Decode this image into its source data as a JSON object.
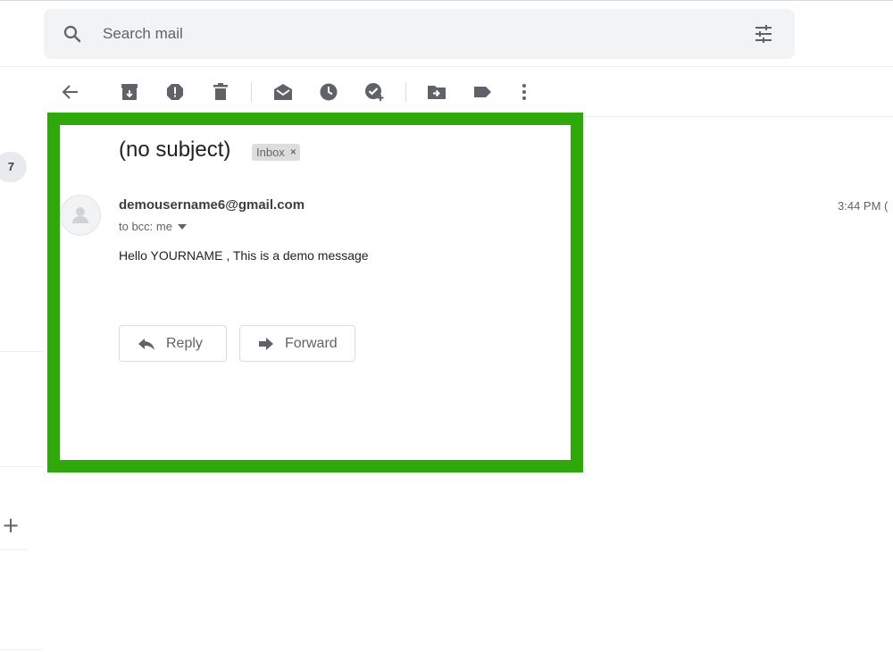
{
  "search": {
    "placeholder": "Search mail",
    "search_icon": "search-icon",
    "options_icon": "tune-icon"
  },
  "toolbar": {
    "icons": [
      "back-arrow-icon",
      "archive-icon",
      "report-spam-icon",
      "delete-icon",
      "mark-unread-icon",
      "snooze-icon",
      "add-to-tasks-icon",
      "move-to-icon",
      "labels-icon",
      "more-vert-icon"
    ]
  },
  "sidebar": {
    "badge_count": "7",
    "add_label_glyph": "+"
  },
  "message": {
    "subject": "(no subject)",
    "label": "Inbox",
    "label_remove": "×",
    "sender": "demousername6@gmail.com",
    "recipients": "to bcc: me",
    "time": "3:44 PM (",
    "body": "Hello YOURNAME , This is a demo message"
  },
  "actions": {
    "reply_label": "Reply",
    "forward_label": "Forward"
  },
  "colors": {
    "highlight": "#2ea80b",
    "search_bg": "#f1f3f4",
    "icon": "#5f6368"
  }
}
